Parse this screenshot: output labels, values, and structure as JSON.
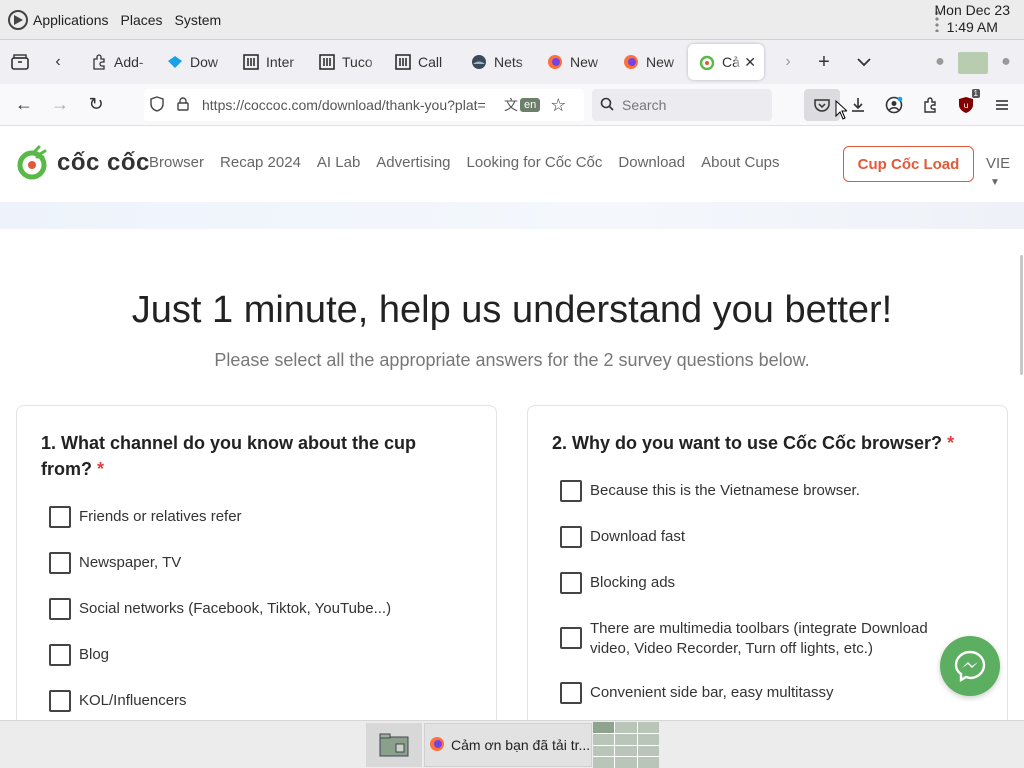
{
  "panel": {
    "menus": [
      "Applications",
      "Places",
      "System"
    ],
    "date": "Mon Dec 23",
    "time": "1:49 AM"
  },
  "tabs": [
    {
      "title": "Add-",
      "icon": "puzzle-icon"
    },
    {
      "title": "Dow",
      "icon": "diamond-icon"
    },
    {
      "title": "Inter",
      "icon": "columns-icon"
    },
    {
      "title": "Tuco",
      "icon": "columns-icon"
    },
    {
      "title": "Call",
      "icon": "columns-icon"
    },
    {
      "title": "Nets",
      "icon": "globe-icon"
    },
    {
      "title": "New",
      "icon": "firefox-icon"
    },
    {
      "title": "New",
      "icon": "firefox-icon"
    },
    {
      "title": "Cả",
      "icon": "coccoc-icon",
      "active": true
    }
  ],
  "nav": {
    "url": "https://coccoc.com/download/thank-you?plat=",
    "lang_badge": "en",
    "search_placeholder": "Search",
    "ublock_count": "1"
  },
  "site": {
    "logo_text": "cốc cốc",
    "nav_items": [
      "Browser",
      "Recap 2024",
      "AI Lab",
      "Advertising",
      "Looking for Cốc Cốc",
      "Download",
      "About Cups"
    ],
    "cta": "Cup Cốc Load",
    "lang": "VIE"
  },
  "survey": {
    "title": "Just 1 minute, help us understand you better!",
    "subtitle": "Please select all the appropriate answers for the 2 survey questions below.",
    "q1": {
      "title": "1. What channel do you know about the cup from?",
      "required": "*",
      "options": [
        "Friends or relatives refer",
        "Newspaper, TV",
        "Social networks (Facebook, Tiktok, YouTube...)",
        "Blog",
        "KOL/Influencers"
      ]
    },
    "q2": {
      "title": "2. Why do you want to use Cốc Cốc browser?",
      "required": "*",
      "options": [
        "Because this is the Vietnamese browser.",
        "Download fast",
        "Blocking ads",
        "There are multimedia toolbars (integrate Download video, Video Recorder, Turn off lights, etc.)",
        "Convenient side bar, easy multitassy"
      ]
    }
  },
  "taskbar": {
    "task_title": "Cảm ơn bạn đã tải tr..."
  },
  "colors": {
    "accent": "#e25a3a",
    "messenger": "#5cae60",
    "required": "#e04040"
  }
}
